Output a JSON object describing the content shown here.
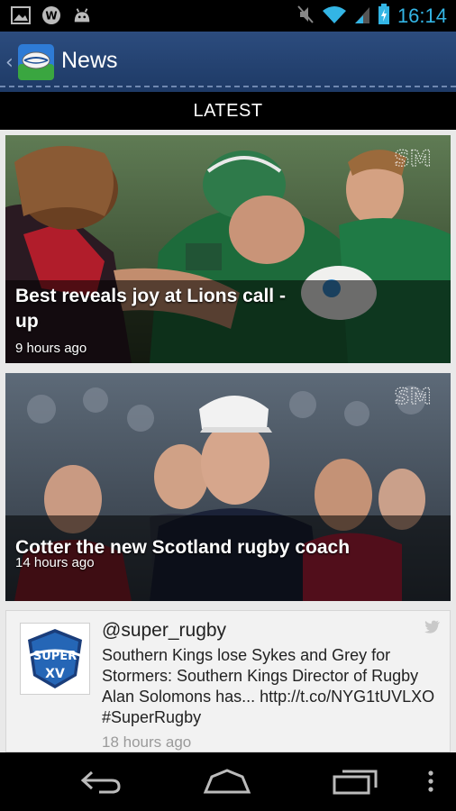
{
  "status_bar": {
    "time": "16:14",
    "left_icons": [
      "image-icon",
      "w-app-icon",
      "android-icon"
    ],
    "right_icons": [
      "mute-icon",
      "wifi-icon",
      "signal-icon",
      "battery-charging-icon"
    ]
  },
  "action_bar": {
    "title": "News",
    "app_icon": "rugby-ball-icon"
  },
  "tab": {
    "label": "LATEST"
  },
  "articles": [
    {
      "headline": "Best reveals joy at Lions call -up",
      "age": "9 hours ago",
      "source_logo": "SM"
    },
    {
      "headline": "Cotter the new Scotland rugby coach",
      "age": "14 hours ago",
      "source_logo": "SM"
    }
  ],
  "tweet": {
    "handle": "@super_rugby",
    "text": "Southern Kings lose Sykes and Grey for Stormers: Southern Kings Director of Rugby Alan Solomons has... http://t.co/NYG1tUVLXO #SuperRugby",
    "age": "18 hours ago",
    "avatar_logo": "SUPER XV"
  },
  "nav_bar": {
    "buttons": [
      "back-icon",
      "home-icon",
      "recent-apps-icon",
      "overflow-menu-icon"
    ]
  },
  "colors": {
    "action_bar": "#2c4c7e",
    "clock": "#33b5e5"
  }
}
